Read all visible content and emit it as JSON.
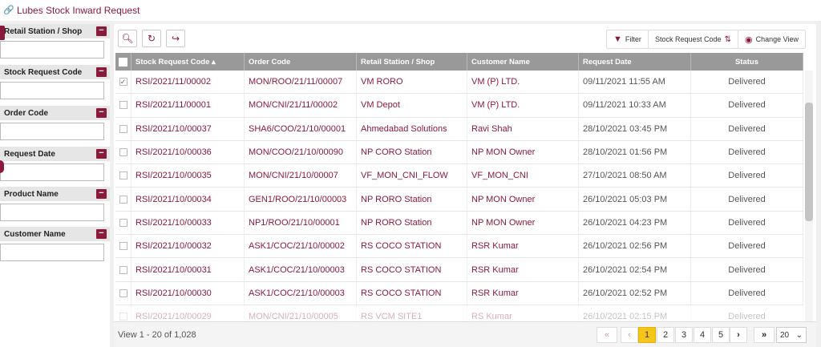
{
  "page": {
    "title": "Lubes Stock Inward Request"
  },
  "filters": [
    {
      "label": "Retail Station / Shop",
      "value": ""
    },
    {
      "label": "Stock Request Code",
      "value": ""
    },
    {
      "label": "Order Code",
      "value": ""
    },
    {
      "label": "Request Date",
      "value": ""
    },
    {
      "label": "Product Name",
      "value": ""
    },
    {
      "label": "Customer Name",
      "value": ""
    }
  ],
  "toolbar": {
    "filter_label": "Filter",
    "sort_label": "Stock Request Code",
    "view_label": "Change View"
  },
  "columns": [
    "Stock Request Code",
    "Order Code",
    "Retail Station / Shop",
    "Customer Name",
    "Request Date",
    "Status"
  ],
  "rows": [
    {
      "code": "RSI/2021/11/00002",
      "order": "MON/ROO/21/11/00007",
      "station": "VM RORO",
      "customer": "VM (P) LTD.",
      "date": "09/11/2021 11:55 AM",
      "status": "Delivered",
      "checked": true
    },
    {
      "code": "RSI/2021/11/00001",
      "order": "MON/CNI/21/11/00002",
      "station": "VM Depot",
      "customer": "VM (P) LTD.",
      "date": "09/11/2021 10:33 AM",
      "status": "Delivered",
      "checked": false
    },
    {
      "code": "RSI/2021/10/00037",
      "order": "SHA6/COO/21/10/00001",
      "station": "Ahmedabad Solutions",
      "customer": "Ravi Shah",
      "date": "28/10/2021 03:45 PM",
      "status": "Delivered",
      "checked": false
    },
    {
      "code": "RSI/2021/10/00036",
      "order": "MON/COO/21/10/00090",
      "station": "NP CORO Station",
      "customer": "NP MON Owner",
      "date": "28/10/2021 01:56 PM",
      "status": "Delivered",
      "checked": false
    },
    {
      "code": "RSI/2021/10/00035",
      "order": "MON/CNI/21/10/00007",
      "station": "VF_MON_CNI_FLOW",
      "customer": "VF_MON_CNI",
      "date": "27/10/2021 08:50 AM",
      "status": "Delivered",
      "checked": false
    },
    {
      "code": "RSI/2021/10/00034",
      "order": "GEN1/ROO/21/10/00003",
      "station": "NP RORO Station",
      "customer": "NP MON Owner",
      "date": "26/10/2021 05:03 PM",
      "status": "Delivered",
      "checked": false
    },
    {
      "code": "RSI/2021/10/00033",
      "order": "NP1/ROO/21/10/00001",
      "station": "NP RORO Station",
      "customer": "NP MON Owner",
      "date": "26/10/2021 04:23 PM",
      "status": "Delivered",
      "checked": false
    },
    {
      "code": "RSI/2021/10/00032",
      "order": "ASK1/COC/21/10/00002",
      "station": "RS COCO STATION",
      "customer": "RSR Kumar",
      "date": "26/10/2021 02:56 PM",
      "status": "Delivered",
      "checked": false
    },
    {
      "code": "RSI/2021/10/00031",
      "order": "ASK1/COC/21/10/00003",
      "station": "RS COCO STATION",
      "customer": "RSR Kumar",
      "date": "26/10/2021 02:54 PM",
      "status": "Delivered",
      "checked": false
    },
    {
      "code": "RSI/2021/10/00030",
      "order": "ASK1/COC/21/10/00003",
      "station": "RS COCO STATION",
      "customer": "RSR Kumar",
      "date": "26/10/2021 02:52 PM",
      "status": "Delivered",
      "checked": false
    },
    {
      "code": "RSI/2021/10/00029",
      "order": "MON/CNI/21/10/00005",
      "station": "RS VCM SITE1",
      "customer": "RS Kumar",
      "date": "26/10/2021 02:15 PM",
      "status": "Delivered",
      "checked": false
    }
  ],
  "pagination": {
    "info": "View 1 - 20 of 1,028",
    "first": "«",
    "prev": "‹",
    "pages": [
      "1",
      "2",
      "3",
      "4",
      "5"
    ],
    "active_page": "1",
    "next": "›",
    "last": "»",
    "page_size": "20"
  },
  "colors": {
    "accent": "#8b1a3a",
    "header_bg": "#999999",
    "active_page": "#f5c518"
  }
}
